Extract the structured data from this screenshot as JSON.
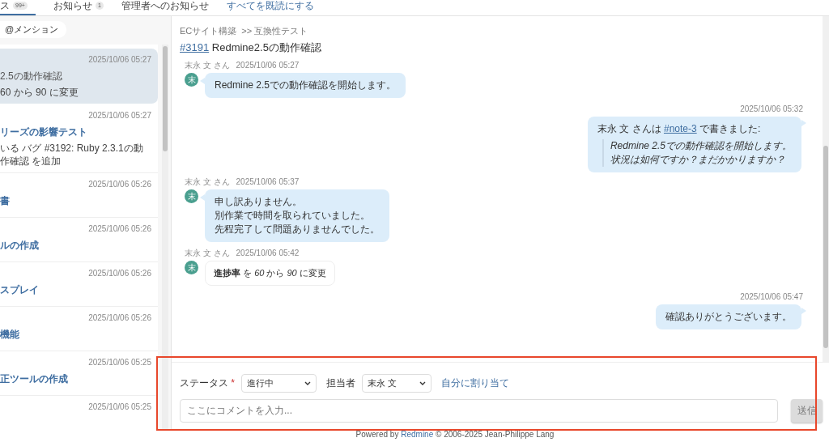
{
  "tabs": [
    {
      "label": "ス",
      "badge": "99+",
      "selected": true
    },
    {
      "label": "お知らせ",
      "badge": "1",
      "selected": false
    },
    {
      "label": "管理者へのお知らせ",
      "selected": false
    }
  ],
  "mark_all_read": "すべてを既読にする",
  "filter_pill": "@メンション",
  "notifications": [
    {
      "time": "2025/10/06 05:27",
      "title": "2.5の動作確認",
      "detail": "60 から 90 に変更",
      "selected": true
    },
    {
      "time": "2025/10/06 05:27",
      "title": "リーズの影響テスト",
      "detail": "いる バグ #3192: Ruby 2.3.1の動作確認 を追加",
      "selected": false
    },
    {
      "time": "2025/10/06 05:26",
      "title": "書",
      "selected": false
    },
    {
      "time": "2025/10/06 05:26",
      "title": "ルの作成",
      "selected": false
    },
    {
      "time": "2025/10/06 05:26",
      "title": "スプレイ",
      "selected": false
    },
    {
      "time": "2025/10/06 05:26",
      "title": "機能",
      "selected": false
    },
    {
      "time": "2025/10/06 05:25",
      "title": "正ツールの作成",
      "selected": false
    },
    {
      "time": "2025/10/06 05:25",
      "selected": false
    }
  ],
  "issue": {
    "project": "ECサイト構築",
    "subproject": ">> 互換性テスト",
    "number": "#3191",
    "subject": "Redmine2.5の動作確認"
  },
  "messages": [
    {
      "kind": "incoming",
      "author": "末永 文 さん",
      "time": "2025/10/06 05:27",
      "avatar": "末",
      "lines": [
        "Redmine 2.5での動作確認を開始します。"
      ]
    },
    {
      "kind": "outgoing",
      "time": "2025/10/06 05:32",
      "quote_author": "末永 文 さんは",
      "quote_link": "#note-3",
      "quote_suffix": "で書きました:",
      "lines": [
        "Redmine 2.5での動作確認を開始します。",
        "状況は如何ですか？まだかかりますか？"
      ]
    },
    {
      "kind": "incoming",
      "author": "末永 文 さん",
      "time": "2025/10/06 05:37",
      "avatar": "末",
      "lines": [
        "申し訳ありません。",
        "別作業で時間を取られていました。",
        "先程完了して問題ありませんでした。"
      ]
    },
    {
      "kind": "change",
      "author": "末永 文 さん",
      "time": "2025/10/06 05:42",
      "avatar": "末",
      "text": "**進捗率** を *60* から *90* に変更"
    },
    {
      "kind": "outgoing",
      "time": "2025/10/06 05:47",
      "lines": [
        "確認ありがとうございます。"
      ]
    }
  ],
  "form": {
    "status_label": "ステータス",
    "status_required_mark": "*",
    "status_value": "進行中",
    "assignee_label": "担当者",
    "assignee_value": "末永 文",
    "assign_me": "自分に割り当て",
    "comment_placeholder": "ここにコメントを入力...",
    "submit": "送信",
    "submit_disabled": true
  },
  "footer": {
    "prefix": "Powered by",
    "link": "Redmine",
    "suffix": "© 2006-2025 Jean-Philippe Lang"
  },
  "annotation": {
    "kind": "highlight"
  }
}
